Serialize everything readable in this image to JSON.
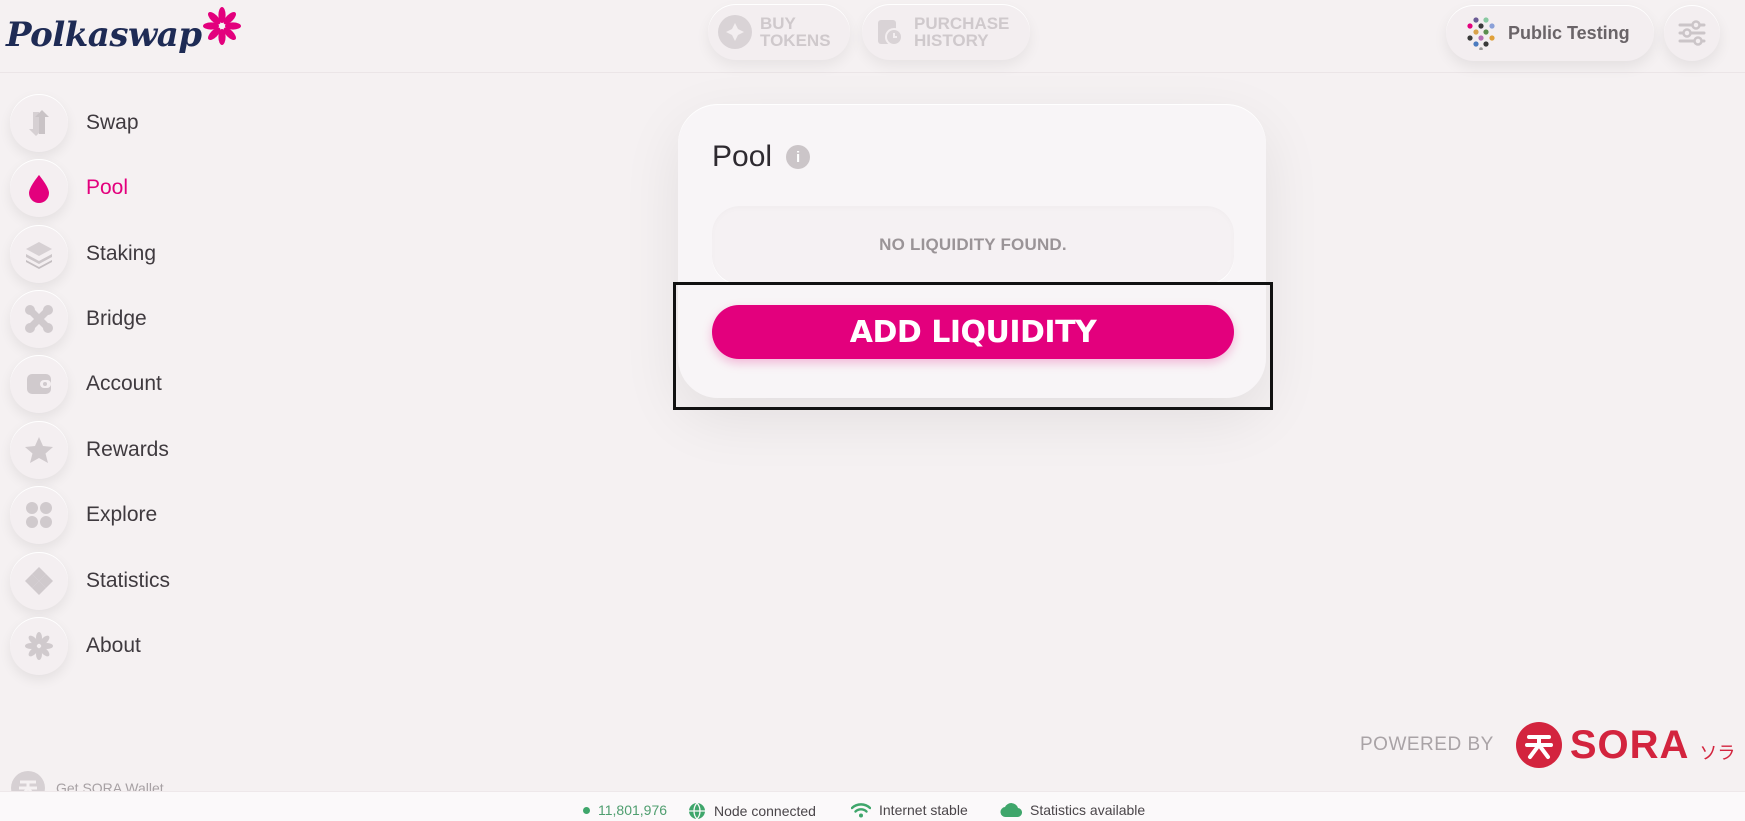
{
  "header": {
    "logo_text": "Polkaswap",
    "buy_tokens": {
      "line1": "BUY",
      "line2": "TOKENS"
    },
    "purchase_history": {
      "line1": "PURCHASE",
      "line2": "HISTORY"
    },
    "network_label": "Public Testing"
  },
  "sidebar": {
    "items": [
      {
        "label": "Swap",
        "icon": "swap-icon"
      },
      {
        "label": "Pool",
        "icon": "drop-icon",
        "active": true
      },
      {
        "label": "Staking",
        "icon": "layers-icon"
      },
      {
        "label": "Bridge",
        "icon": "bridge-icon"
      },
      {
        "label": "Account",
        "icon": "wallet-icon"
      },
      {
        "label": "Rewards",
        "icon": "star-icon"
      },
      {
        "label": "Explore",
        "icon": "grid-icon"
      },
      {
        "label": "Statistics",
        "icon": "diamond-icon"
      },
      {
        "label": "About",
        "icon": "flower-icon"
      }
    ],
    "wallet_link": "Get SORA Wallet"
  },
  "pool_card": {
    "title": "Pool",
    "empty_message": "NO LIQUIDITY FOUND.",
    "add_button": "ADD LIQUIDITY"
  },
  "powered_by": {
    "label": "POWERED BY",
    "brand": "SORA",
    "kana": "ソラ"
  },
  "footer": {
    "block_number": "11,801,976",
    "node_status": "Node connected",
    "internet_status": "Internet stable",
    "statistics_status": "Statistics available"
  },
  "colors": {
    "accent": "#e3007d",
    "sora_red": "#d3243e",
    "background": "#f5f1f2",
    "status_green": "#3fa66b"
  }
}
